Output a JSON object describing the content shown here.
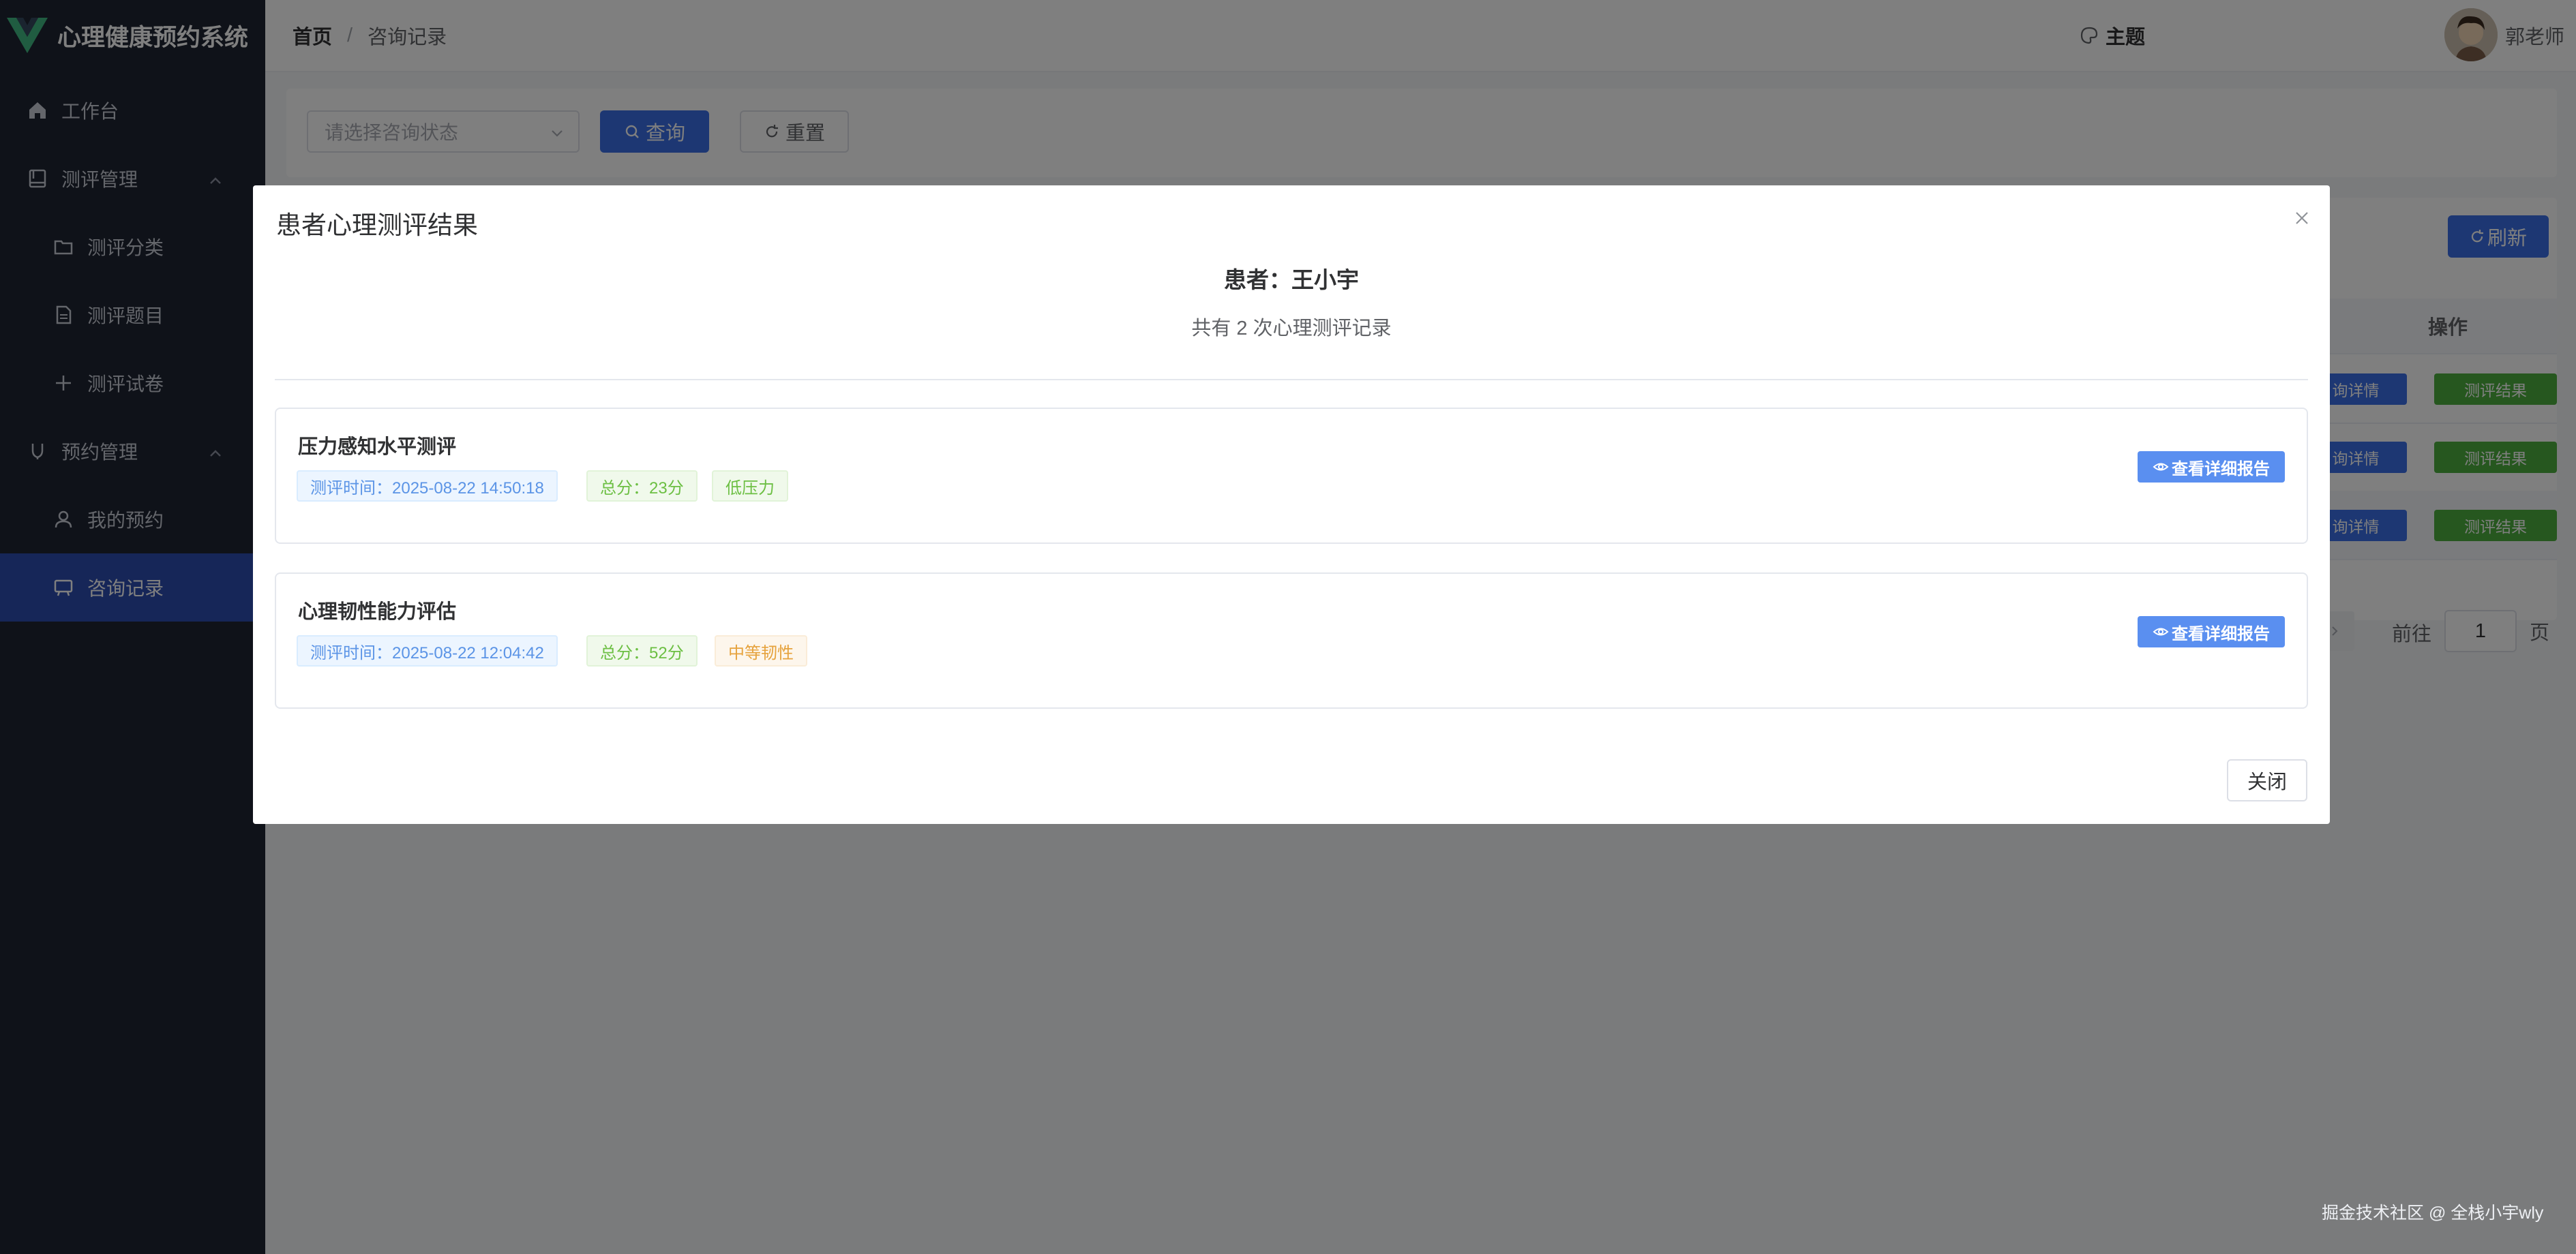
{
  "app": {
    "title": "心理健康预约系统"
  },
  "sidebar": {
    "items": [
      {
        "label": "工作台",
        "icon": "home-icon"
      },
      {
        "label": "测评管理",
        "icon": "assessment-icon"
      },
      {
        "label": "测评分类",
        "icon": "folder-icon"
      },
      {
        "label": "测评题目",
        "icon": "document-icon"
      },
      {
        "label": "测评试卷",
        "icon": "plus-icon"
      },
      {
        "label": "预约管理",
        "icon": "appointment-icon"
      },
      {
        "label": "我的预约",
        "icon": "user-icon"
      },
      {
        "label": "咨询记录",
        "icon": "chat-icon"
      }
    ]
  },
  "header": {
    "breadcrumb_home": "首页",
    "breadcrumb_sep": "/",
    "breadcrumb_current": "咨询记录",
    "theme_label": "主题",
    "user_name": "郭老师"
  },
  "filters": {
    "status_placeholder": "请选择咨询状态",
    "query_label": "查询",
    "reset_label": "重置"
  },
  "table": {
    "refresh_label": "刷新",
    "ops_header": "操作",
    "detail_btn": "询详情",
    "result_btn": "测评结果"
  },
  "pagination": {
    "goto_label": "前往",
    "page_value": "1",
    "page_suffix": "页"
  },
  "dialog": {
    "title": "患者心理测评结果",
    "patient": "患者：王小宇",
    "count": "共有 2 次心理测评记录",
    "records": [
      {
        "title": "压力感知水平测评",
        "time": "测评时间：2025-08-22 14:50:18",
        "score": "总分：23分",
        "level": "低压力",
        "report_label": "查看详细报告"
      },
      {
        "title": "心理韧性能力评估",
        "time": "测评时间：2025-08-22 12:04:42",
        "score": "总分：52分",
        "level": "中等韧性",
        "report_label": "查看详细报告"
      }
    ],
    "close_label": "关闭"
  },
  "watermark": "掘金技术社区 @ 全栈小宇wly",
  "colors": {
    "primary": "#3a6fe6",
    "sidebar": "#1e2433",
    "success": "#4caf3e",
    "warning": "#e6a23c"
  }
}
